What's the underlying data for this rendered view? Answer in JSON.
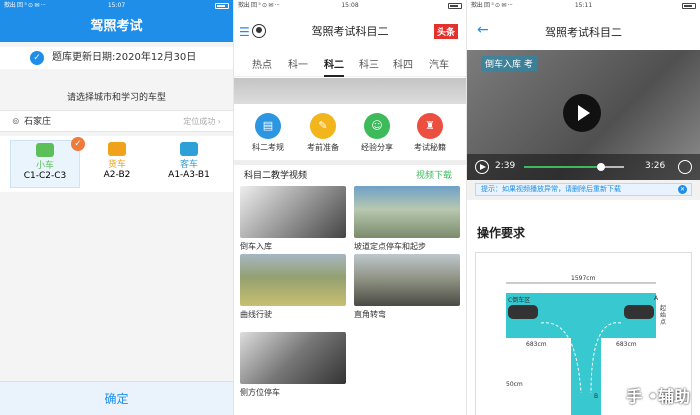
{
  "panel1": {
    "status": {
      "left": "揿出 回 ⁵ ⊙ ✉ ···",
      "time": "15:07"
    },
    "title": "驾照考试",
    "update_date": "题库更新日期:2020年12月30日",
    "prompt": "请选择城市和学习的车型",
    "city": "石家庄",
    "location_status": "定位成功 ›",
    "vehicle_types": [
      {
        "name": "小车",
        "code": "C1-C2-C3",
        "selected": true,
        "color": "#5cbf5a"
      },
      {
        "name": "货车",
        "code": "A2-B2",
        "selected": false,
        "color": "#f0a21a"
      },
      {
        "name": "客车",
        "code": "A1-A3-B1",
        "selected": false,
        "color": "#2f9fd8"
      }
    ],
    "confirm": "确定"
  },
  "panel2": {
    "status": {
      "left": "揿出 回 ⁵ ⊙ ✉ ···",
      "time": "15:08"
    },
    "title": "驾照考试科目二",
    "badge": "头条",
    "tabs": [
      "热点",
      "科一",
      "科二",
      "科三",
      "科四",
      "汽车"
    ],
    "active_tab": "科二",
    "icons": [
      {
        "label": "科二考规",
        "color": "#2c96e0",
        "glyph": "▤"
      },
      {
        "label": "考前准备",
        "color": "#f2b51c",
        "glyph": "✎"
      },
      {
        "label": "经验分享",
        "color": "#3dbb5a",
        "glyph": "☺"
      },
      {
        "label": "考试秘籍",
        "color": "#ec4e3f",
        "glyph": "♜"
      }
    ],
    "section_title": "科目二教学视频",
    "section_link": "视频下载",
    "videos": [
      {
        "title": "倒车入库"
      },
      {
        "title": "坡道定点停车和起步"
      },
      {
        "title": "曲线行驶"
      },
      {
        "title": "直角转弯"
      },
      {
        "title": "侧方位停车"
      }
    ]
  },
  "panel3": {
    "status": {
      "left": "揿出 回 ⁵ ⊙ ✉ ···",
      "time": "15:11"
    },
    "title": "驾照考试科目二",
    "video_overlay_title": "倒车入库 考",
    "time_current": "2:39",
    "time_total": "3:26",
    "progress": 0.77,
    "tip": "提示：如果视频播放异常，请删除后重新下载",
    "heading": "操作要求",
    "diagram_labels": {
      "width": "1597cm",
      "zone": "C倒车区",
      "left_dim": "683cm",
      "right_dim": "683cm",
      "scale": "50cm",
      "a": "A",
      "b": "B",
      "start": "起始点"
    },
    "watermark": "手 •辅助"
  }
}
